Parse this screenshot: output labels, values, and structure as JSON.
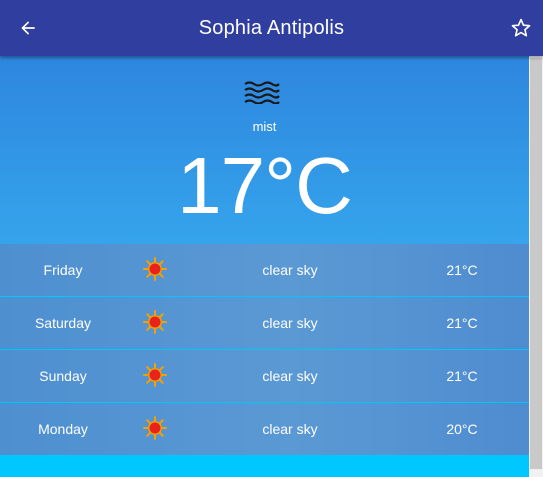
{
  "header": {
    "title": "Sophia Antipolis",
    "back_icon": "arrow-left-icon",
    "favorite_icon": "star-outline-icon"
  },
  "current": {
    "condition": "mist",
    "condition_icon": "mist-icon",
    "temperature": "17°C"
  },
  "forecast": [
    {
      "day": "Friday",
      "icon": "sun-icon",
      "description": "clear sky",
      "temp": "21°C"
    },
    {
      "day": "Saturday",
      "icon": "sun-icon",
      "description": "clear sky",
      "temp": "21°C"
    },
    {
      "day": "Sunday",
      "icon": "sun-icon",
      "description": "clear sky",
      "temp": "21°C"
    },
    {
      "day": "Monday",
      "icon": "sun-icon",
      "description": "clear sky",
      "temp": "20°C"
    }
  ],
  "colors": {
    "app_bar": "#303f9f",
    "current_top": "#2e86de",
    "current_bottom": "#35a4ec",
    "forecast_row": "#5b99d4",
    "bottom_fill": "#00c8ff"
  }
}
